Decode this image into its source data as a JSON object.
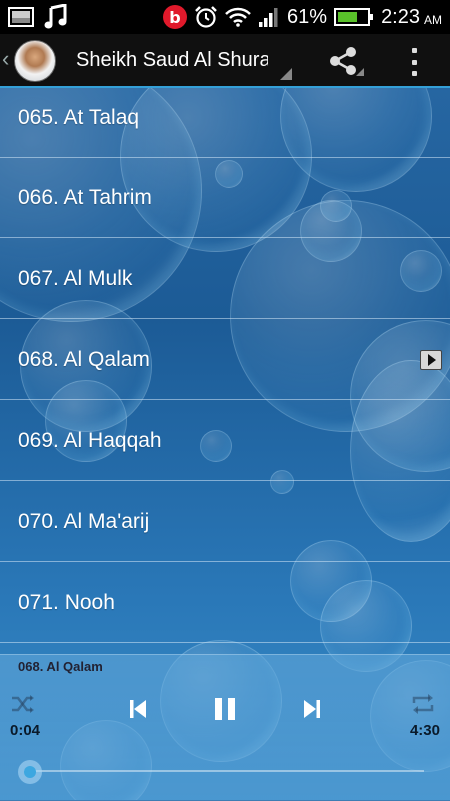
{
  "status_bar": {
    "battery_percent": "61%",
    "time": "2:23",
    "ampm": "AM",
    "beats_letter": "b"
  },
  "action_bar": {
    "title": "Sheikh Saud Al Shuraim"
  },
  "surahs": [
    {
      "label": "065. At Talaq",
      "playing": false
    },
    {
      "label": "066. At Tahrim",
      "playing": false
    },
    {
      "label": "067. Al Mulk",
      "playing": false
    },
    {
      "label": "068. Al Qalam",
      "playing": true
    },
    {
      "label": "069. Al Haqqah",
      "playing": false
    },
    {
      "label": "070. Al Ma'arij",
      "playing": false
    },
    {
      "label": "071. Nooh",
      "playing": false
    }
  ],
  "player": {
    "now_playing": "068. Al Qalam",
    "elapsed": "0:04",
    "duration": "4:30",
    "progress_fraction": 0.015
  },
  "colors": {
    "accent": "#34a0d8",
    "beats_red": "#e0192b",
    "battery_green": "#59c02a"
  }
}
